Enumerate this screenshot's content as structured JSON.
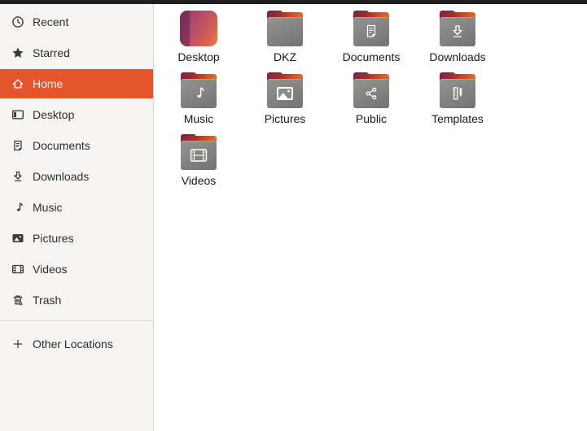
{
  "sidebar": {
    "items": [
      {
        "label": "Recent",
        "icon": "recent-icon",
        "selected": false
      },
      {
        "label": "Starred",
        "icon": "star-icon",
        "selected": false
      },
      {
        "label": "Home",
        "icon": "home-icon",
        "selected": true
      },
      {
        "label": "Desktop",
        "icon": "desktop-icon",
        "selected": false
      },
      {
        "label": "Documents",
        "icon": "documents-icon",
        "selected": false
      },
      {
        "label": "Downloads",
        "icon": "downloads-icon",
        "selected": false
      },
      {
        "label": "Music",
        "icon": "music-icon",
        "selected": false
      },
      {
        "label": "Pictures",
        "icon": "pictures-icon",
        "selected": false
      },
      {
        "label": "Videos",
        "icon": "videos-icon",
        "selected": false
      },
      {
        "label": "Trash",
        "icon": "trash-icon",
        "selected": false
      }
    ],
    "other": {
      "label": "Other Locations",
      "icon": "plus-icon"
    }
  },
  "main": {
    "folders": [
      {
        "name": "Desktop",
        "icon": "desktop-preview-tile"
      },
      {
        "name": "DKZ",
        "icon": "plain-folder"
      },
      {
        "name": "Documents",
        "icon": "folder-with-document-emblem"
      },
      {
        "name": "Downloads",
        "icon": "folder-with-download-emblem"
      },
      {
        "name": "Music",
        "icon": "folder-with-music-emblem"
      },
      {
        "name": "Pictures",
        "icon": "folder-with-image-emblem"
      },
      {
        "name": "Public",
        "icon": "folder-with-share-emblem"
      },
      {
        "name": "Templates",
        "icon": "folder-with-template-emblem"
      },
      {
        "name": "Videos",
        "icon": "folder-with-film-emblem"
      }
    ]
  },
  "colors": {
    "accent": "#E6542C",
    "topbar": "#1F1F1F",
    "sidebar_bg": "#F6F5F4",
    "folder_gray": "#82817F",
    "folder_flap_dark": "#7E2444",
    "folder_flap_orange": "#E0611F"
  }
}
